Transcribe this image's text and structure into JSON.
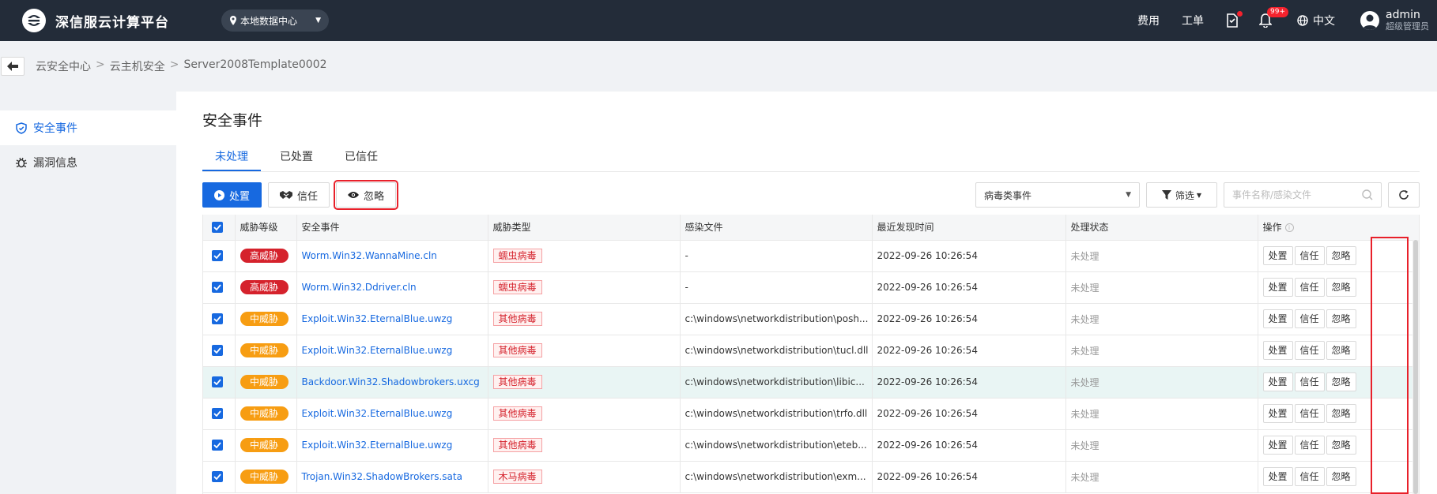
{
  "topbar": {
    "brand_name": "深信服云计算平台",
    "datacenter": "本地数据中心",
    "links": [
      "费用",
      "工单"
    ],
    "notification_count": "99+",
    "language": "中文",
    "user_name": "admin",
    "user_role": "超级管理员"
  },
  "breadcrumb": [
    "云安全中心",
    "云主机安全",
    "Server2008Template0002"
  ],
  "breadcrumb_sep": ">",
  "sidebar": {
    "items": [
      {
        "label": "安全事件",
        "icon": "shield-check-icon",
        "active": true
      },
      {
        "label": "漏洞信息",
        "icon": "bug-icon",
        "active": false
      }
    ]
  },
  "page_title": "安全事件",
  "tabs": [
    {
      "label": "未处理",
      "active": true
    },
    {
      "label": "已处置",
      "active": false
    },
    {
      "label": "已信任",
      "active": false
    }
  ],
  "toolbar": {
    "handle_label": "处置",
    "trust_label": "信任",
    "ignore_label": "忽略",
    "event_type": "病毒类事件",
    "filter_label": "筛选",
    "search_placeholder": "事件名称/感染文件"
  },
  "table": {
    "headers": [
      "威胁等级",
      "安全事件",
      "威胁类型",
      "感染文件",
      "最近发现时间",
      "处理状态",
      "操作"
    ],
    "action_labels": {
      "handle": "处置",
      "trust": "信任",
      "ignore": "忽略"
    },
    "rows": [
      {
        "level": "高威胁",
        "level_kind": "high",
        "event": "Worm.Win32.WannaMine.cln",
        "type": "蠕虫病毒",
        "file": "-",
        "time": "2022-09-26 10:26:54",
        "status": "未处理"
      },
      {
        "level": "高威胁",
        "level_kind": "high",
        "event": "Worm.Win32.Ddriver.cln",
        "type": "蠕虫病毒",
        "file": "-",
        "time": "2022-09-26 10:26:54",
        "status": "未处理"
      },
      {
        "level": "中威胁",
        "level_kind": "mid",
        "event": "Exploit.Win32.EternalBlue.uwzg",
        "type": "其他病毒",
        "file": "c:\\windows\\networkdistribution\\posh...",
        "time": "2022-09-26 10:26:54",
        "status": "未处理"
      },
      {
        "level": "中威胁",
        "level_kind": "mid",
        "event": "Exploit.Win32.EternalBlue.uwzg",
        "type": "其他病毒",
        "file": "c:\\windows\\networkdistribution\\tucl.dll",
        "time": "2022-09-26 10:26:54",
        "status": "未处理"
      },
      {
        "level": "中威胁",
        "level_kind": "mid",
        "event": "Backdoor.Win32.Shadowbrokers.uxcg",
        "type": "其他病毒",
        "file": "c:\\windows\\networkdistribution\\libic...",
        "time": "2022-09-26 10:26:54",
        "status": "未处理"
      },
      {
        "level": "中威胁",
        "level_kind": "mid",
        "event": "Exploit.Win32.EternalBlue.uwzg",
        "type": "其他病毒",
        "file": "c:\\windows\\networkdistribution\\trfo.dll",
        "time": "2022-09-26 10:26:54",
        "status": "未处理"
      },
      {
        "level": "中威胁",
        "level_kind": "mid",
        "event": "Exploit.Win32.EternalBlue.uwzg",
        "type": "其他病毒",
        "file": "c:\\windows\\networkdistribution\\eteb...",
        "time": "2022-09-26 10:26:54",
        "status": "未处理"
      },
      {
        "level": "中威胁",
        "level_kind": "mid",
        "event": "Trojan.Win32.ShadowBrokers.sata",
        "type": "木马病毒",
        "file": "c:\\windows\\networkdistribution\\exm...",
        "time": "2022-09-26 10:26:54",
        "status": "未处理"
      }
    ]
  },
  "colors": {
    "topbar_bg": "#232c39",
    "primary": "#1769e0",
    "high_threat": "#d5222c",
    "mid_threat": "#f79d12",
    "highlight_box": "#e8202a"
  }
}
